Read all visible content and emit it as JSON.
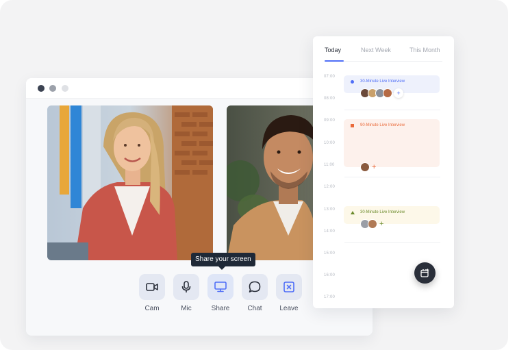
{
  "call": {
    "tooltip": "Share your screen",
    "controls": [
      {
        "label": "Cam",
        "icon": "video-camera-icon"
      },
      {
        "label": "Mic",
        "icon": "microphone-icon"
      },
      {
        "label": "Share",
        "icon": "monitor-share-icon"
      },
      {
        "label": "Chat",
        "icon": "chat-bubble-icon"
      },
      {
        "label": "Leave",
        "icon": "close-square-icon"
      }
    ]
  },
  "calendar": {
    "tabs": [
      "Today",
      "Next Week",
      "This Month"
    ],
    "active_tab": "Today",
    "times": [
      "07:00",
      "08:00",
      "09:00",
      "10:00",
      "11:00",
      "12:00",
      "13:00",
      "14:00",
      "15:00",
      "16:00",
      "17:00"
    ],
    "events": [
      {
        "title": "30-Minute Live Interview",
        "color": "#4f6ef7",
        "attendees": 4
      },
      {
        "title": "90-Minute Live Interview",
        "color": "#ea6a3a",
        "attendees": 1
      },
      {
        "title": "30-Minute Live Interview",
        "color": "#6a8a2a",
        "attendees": 2
      }
    ],
    "add_symbol": "+"
  },
  "colors": {
    "accent": "#4f6ef7",
    "dark": "#2a2f3a"
  }
}
